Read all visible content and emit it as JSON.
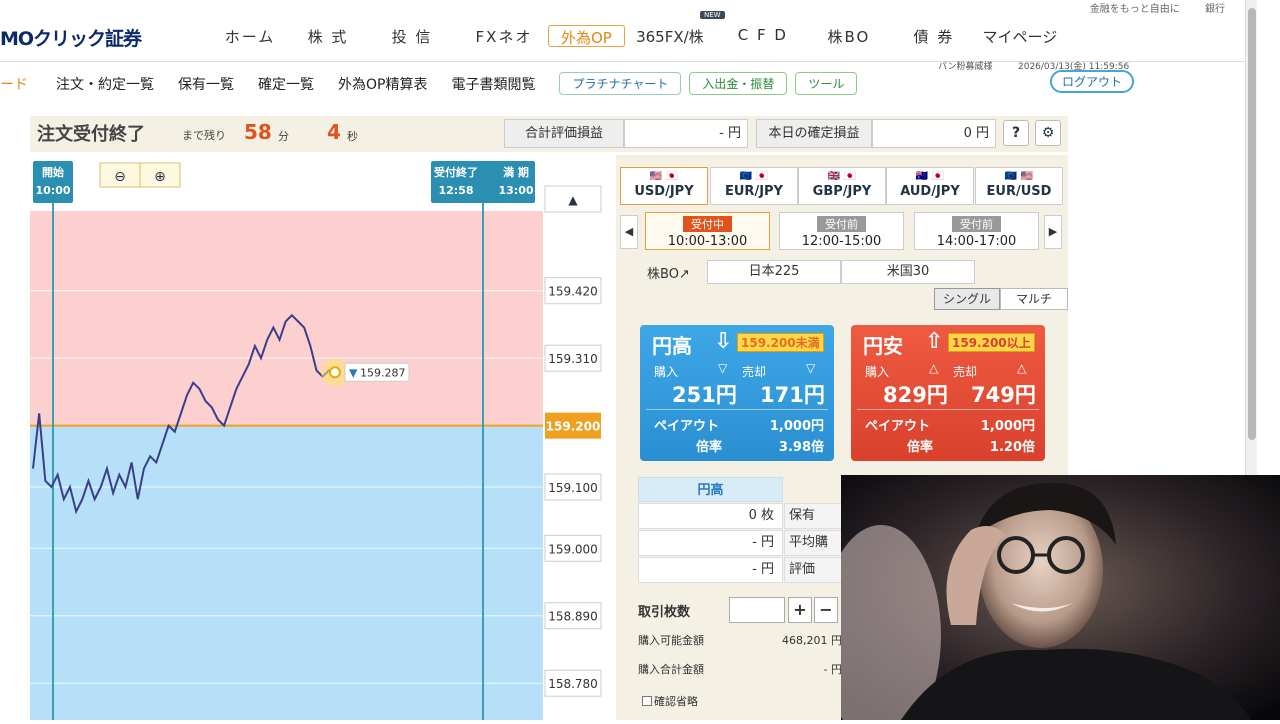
{
  "header": {
    "logo": "MOクリック証券",
    "topstrip": [
      "金融をもっと自由に",
      "銀行"
    ],
    "nav": [
      "ホーム",
      "株 式",
      "投 信",
      "FXネオ",
      "外為OP",
      "365FX/株",
      "C F D",
      "株BO",
      "債 券",
      "マイページ"
    ],
    "new_badge": "NEW",
    "active_nav": "外為OP"
  },
  "subnav": {
    "first": "ード",
    "links": [
      "注文・約定一覧",
      "保有一覧",
      "確定一覧",
      "外為OP精算表",
      "電子書類閲覧"
    ],
    "buttons": [
      "プラチナチャート",
      "入出金・振替",
      "ツール"
    ],
    "user": "パン粉募威様",
    "datetime": "2026/03/13(金) 11:59:56",
    "logout": "ログアウト"
  },
  "panel": {
    "status": "注文受付終了",
    "remaining_label": "まで残り",
    "minutes": "58",
    "minutes_unit": "分",
    "seconds": "4",
    "seconds_unit": "秒",
    "total_pl_label": "合計評価損益",
    "total_pl_value": "- 円",
    "today_pl_label": "本日の確定損益",
    "today_pl_value": "0 円",
    "help": "?",
    "settings": "⚙"
  },
  "chart": {
    "start_label": "開始",
    "start_time": "10:00",
    "accept_end_label": "受付終了",
    "accept_end_time": "12:58",
    "expire_label": "満 期",
    "expire_time": "13:00",
    "zoom_out": "🔍",
    "zoom_in": "🔍",
    "current_price": "159.287",
    "target_price": "159.200",
    "up_arrow": "▲"
  },
  "chart_data": {
    "type": "line",
    "y_ticks": [
      "159.420",
      "159.310",
      "159.200",
      "159.100",
      "159.000",
      "158.890",
      "158.780"
    ],
    "ylim": [
      158.72,
      159.55
    ],
    "strike": 159.2,
    "current": 159.287,
    "values": [
      159.13,
      159.22,
      159.11,
      159.1,
      159.12,
      159.08,
      159.1,
      159.06,
      159.08,
      159.11,
      159.08,
      159.1,
      159.13,
      159.09,
      159.12,
      159.1,
      159.14,
      159.08,
      159.13,
      159.15,
      159.14,
      159.17,
      159.2,
      159.19,
      159.22,
      159.25,
      159.27,
      159.26,
      159.24,
      159.23,
      159.21,
      159.2,
      159.23,
      159.26,
      159.28,
      159.3,
      159.33,
      159.31,
      159.34,
      159.36,
      159.34,
      159.37,
      159.38,
      159.37,
      159.36,
      159.33,
      159.29,
      159.28,
      159.29,
      159.287
    ]
  },
  "pairs": {
    "tabs": [
      "USD/JPY",
      "EUR/JPY",
      "GBP/JPY",
      "AUD/JPY",
      "EUR/USD"
    ],
    "flags": [
      "🇺🇸 🇯🇵",
      "🇪🇺 🇯🇵",
      "🇬🇧 🇯🇵",
      "🇦🇺 🇯🇵",
      "🇪🇺 🇺🇸"
    ],
    "active": "USD/JPY"
  },
  "slots": [
    {
      "tag": "受付中",
      "time": "10:00-13:00"
    },
    {
      "tag": "受付前",
      "time": "12:00-15:00"
    },
    {
      "tag": "受付前",
      "time": "14:00-17:00"
    }
  ],
  "stock_bo": {
    "label": "株BO↗",
    "items": [
      "日本225",
      "米国30"
    ]
  },
  "modes": [
    "シングル",
    "マルチ"
  ],
  "cards": {
    "high": {
      "title": "円高",
      "arrow": "⇩",
      "tag": "159.200未満",
      "buy_label": "購入",
      "sell_label": "売却",
      "buy_price": "251円",
      "sell_price": "171円",
      "payout_label": "ペイアウト",
      "payout": "1,000円",
      "ratio_label": "倍率",
      "ratio": "3.98倍"
    },
    "low": {
      "title": "円安",
      "arrow": "⇧",
      "tag": "159.200以上",
      "buy_label": "購入",
      "sell_label": "売却",
      "buy_price": "829円",
      "sell_price": "749円",
      "payout_label": "ペイアウト",
      "payout": "1,000円",
      "ratio_label": "倍率",
      "ratio": "1.20倍"
    }
  },
  "positions": {
    "header": "円高",
    "rows": [
      {
        "value": "0 枚",
        "label": "保有"
      },
      {
        "value": "- 円",
        "label": "平均購"
      },
      {
        "value": "- 円",
        "label": "評価"
      }
    ]
  },
  "order": {
    "lot_label": "取引枚数",
    "plus": "+",
    "minus": "−",
    "buyable_label": "購入可能金額",
    "buyable_value": "468,201 円",
    "total_label": "購入合計金額",
    "total_value": "- 円",
    "confirm_skip": "確認省略"
  }
}
